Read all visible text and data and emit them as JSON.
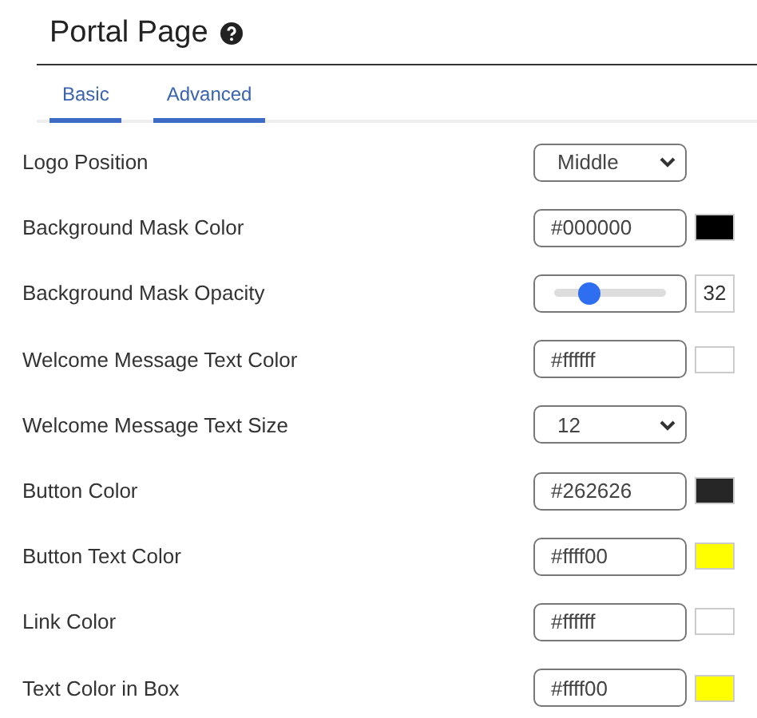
{
  "header": {
    "title": "Portal Page"
  },
  "tabs": [
    {
      "label": "Basic",
      "selected": true
    },
    {
      "label": "Advanced",
      "selected": true
    }
  ],
  "settings": [
    {
      "kind": "select",
      "label": "Logo Position",
      "value": "Middle"
    },
    {
      "kind": "color",
      "label": "Background Mask Color",
      "value": "#000000",
      "color": "#000000"
    },
    {
      "kind": "slider",
      "label": "Background Mask Opacity",
      "level": 0.32,
      "reading": "32"
    },
    {
      "kind": "color",
      "label": "Welcome Message Text Color",
      "value": "#ffffff",
      "color": "#ffffff"
    },
    {
      "kind": "select",
      "label": "Welcome Message Text Size",
      "value": "12"
    },
    {
      "kind": "color",
      "label": "Button Color",
      "value": "#262626",
      "color": "#262626"
    },
    {
      "kind": "color",
      "label": "Button Text Color",
      "value": "#ffff00",
      "color": "#ffff00"
    },
    {
      "kind": "color",
      "label": "Link Color",
      "value": "#ffffff",
      "color": "#ffffff"
    },
    {
      "kind": "color",
      "label": "Text Color in Box",
      "value": "#ffff00",
      "color": "#ffff00"
    }
  ]
}
